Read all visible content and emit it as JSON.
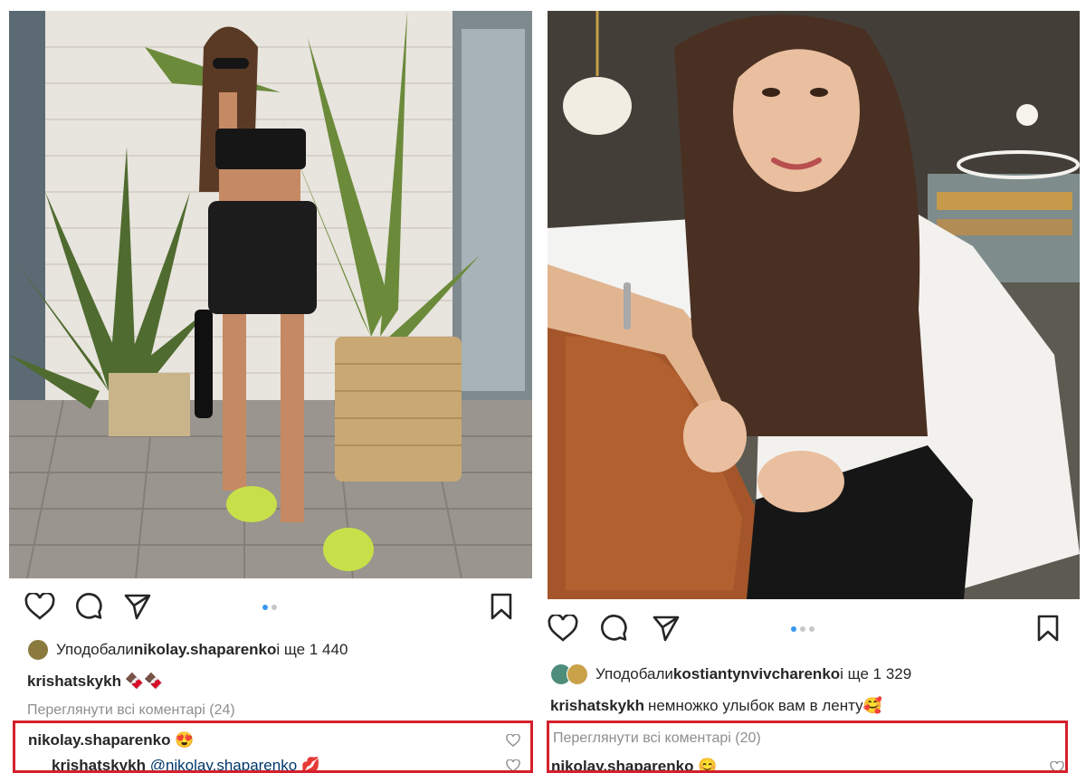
{
  "left_post": {
    "likes": {
      "prefix": "Уподобали ",
      "user": "nikolay.shaparenko",
      "suffix": " і ще 1 440"
    },
    "caption": {
      "user": "krishatskykh",
      "text": "🍫🍫"
    },
    "view_all": "Переглянути всі коментарі (24)",
    "comments": [
      {
        "user": "nikolay.shaparenko",
        "text": "😍"
      },
      {
        "user": "krishatskykh",
        "mention": "@nikolay.shaparenko",
        "text": "💋"
      }
    ]
  },
  "right_post": {
    "likes": {
      "prefix": "Уподобали ",
      "user": "kostiantynvivcharenko",
      "suffix": " і ще 1 329"
    },
    "caption": {
      "user": "krishatskykh",
      "text": "немножко улыбок вам в ленту🥰"
    },
    "view_all": "Переглянути всі коментарі (20)",
    "comments": [
      {
        "user": "nikolay.shaparenko",
        "text": "😊"
      }
    ]
  },
  "icons": [
    "heart-icon",
    "comment-icon",
    "share-icon",
    "bookmark-icon"
  ],
  "colors": {
    "highlight_border": "#d3202c",
    "carousel_active": "#3897f0",
    "muted_text": "#8e8e8e",
    "mention": "#00376b"
  }
}
